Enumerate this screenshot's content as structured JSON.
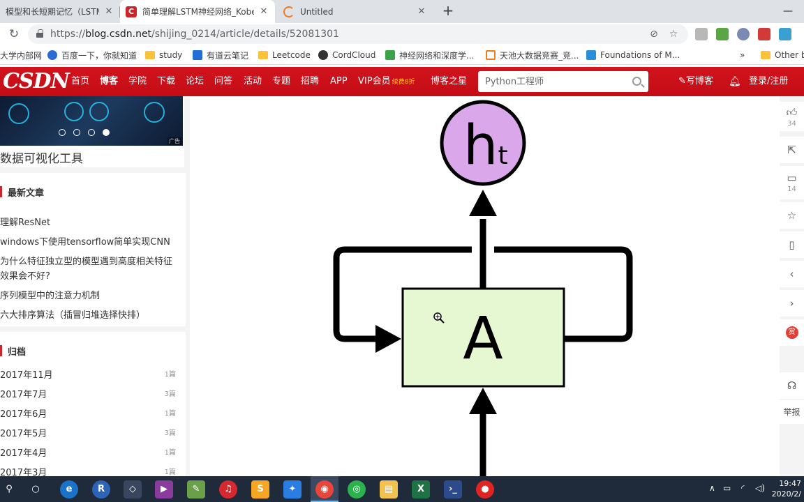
{
  "tabs": [
    {
      "title": "模型和长短期记忆（LSTM）",
      "active": false
    },
    {
      "title": "简单理解LSTM神经网络_Kobe B",
      "active": true
    },
    {
      "title": "Untitled",
      "active": false
    }
  ],
  "address": {
    "scheme": "https://",
    "host": "blog.csdn.net",
    "path": "/shijing_0214/article/details/52081301"
  },
  "bookmarks": [
    "大学内部网",
    "百度一下，你就知道",
    "study",
    "有道云笔记",
    "Leetcode",
    "CordCloud",
    "神经网络和深度学...",
    "天池大数据竞赛_竞...",
    "Foundations of M...",
    "Other b"
  ],
  "csdn_nav": {
    "logo": "CSDN",
    "links": [
      "首页",
      "博客",
      "学院",
      "下载",
      "论坛",
      "问答",
      "活动",
      "专题",
      "招聘",
      "APP",
      "VIP会员"
    ],
    "vip_badge": "续费8折",
    "blog_star": "博客之星",
    "search_placeholder": "Python工程师",
    "write_blog": "写博客",
    "login": "登录/注册"
  },
  "sidebar": {
    "ad_title": "数据可视化工具",
    "ad_tag": "广告",
    "recent_title": "最新文章",
    "recent_articles": [
      "理解ResNet",
      "windows下使用tensorflow简单实现CNN",
      "为什么特征独立型的模型遇到高度相关特征",
      "效果会不好?",
      "序列模型中的注意力机制",
      "六大排序算法（插冒归堆选择快排）"
    ],
    "archive_title": "归档",
    "archive": [
      {
        "month": "2017年11月",
        "count": "1篇"
      },
      {
        "month": "2017年7月",
        "count": "3篇"
      },
      {
        "month": "2017年6月",
        "count": "1篇"
      },
      {
        "month": "2017年5月",
        "count": "3篇"
      },
      {
        "month": "2017年4月",
        "count": "1篇"
      },
      {
        "month": "2017年3月",
        "count": "1篇"
      }
    ]
  },
  "diagram": {
    "output_label": "h",
    "output_subscript": "t",
    "cell_label": "A",
    "cell_fill": "#e6f8d2",
    "output_fill": "#d9a7ea"
  },
  "right_toolbar": {
    "likes": "34",
    "comments": "14",
    "reward": "赏",
    "report": "举报"
  },
  "taskbar": {
    "time": "19:47",
    "date": "2020/2/"
  }
}
